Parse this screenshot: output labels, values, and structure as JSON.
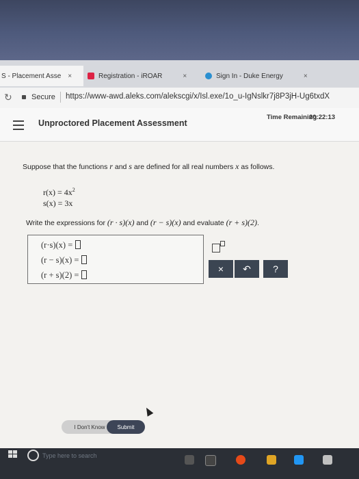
{
  "browser": {
    "tabs": [
      {
        "label": "S - Placement Asse",
        "close": "×"
      },
      {
        "label": "Registration - iROAR",
        "close": "×"
      },
      {
        "label": "Sign In - Duke Energy",
        "close": "×"
      }
    ],
    "secure_label": "Secure",
    "url": "https://www-awd.aleks.com/alekscgi/x/Isl.exe/1o_u-IgNslkr7j8P3jH-Ug6txdX"
  },
  "header": {
    "title": "Unproctored Placement Assessment",
    "time_label": "Time Remaining",
    "time_value": "20:22:13"
  },
  "question": {
    "prompt_start": "Suppose that the functions ",
    "r": "r",
    "and": " and ",
    "s": "s",
    "prompt_end": " are defined for all real numbers ",
    "x": "x",
    "prompt_tail": " as follows.",
    "def_r_left": "r(x) = 4x",
    "def_r_exp": "2",
    "def_s": "s(x) = 3x",
    "write_start": "Write the expressions for ",
    "expr1": "(r · s)(x)",
    "write_and": " and ",
    "expr2": "(r − s)(x)",
    "write_mid": " and evaluate ",
    "expr3": "(r + s)(2)",
    "write_end": "."
  },
  "answers": [
    {
      "label": "(r·s)(x) ="
    },
    {
      "label": "(r − s)(x) ="
    },
    {
      "label": "(r + s)(2) ="
    }
  ],
  "tools": {
    "clear": "×",
    "undo": "↶",
    "help": "?"
  },
  "footer": {
    "dont_know": "I Don't Know",
    "submit": "Submit"
  },
  "taskbar": {
    "search_placeholder": "Type here to search"
  }
}
